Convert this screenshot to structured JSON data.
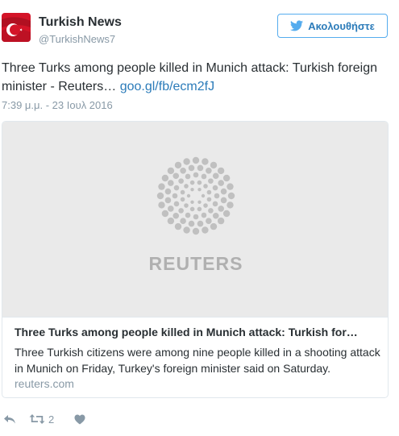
{
  "account": {
    "name": "Turkish News",
    "handle": "@TurkishNews7"
  },
  "follow_button": {
    "label": "Ακολουθήστε",
    "icon": "bird-icon"
  },
  "tweet": {
    "text": "Three Turks among people killed in Munich attack: Turkish foreign minister - Reuters…",
    "link": "goo.gl/fb/ecm2fJ",
    "timestamp": "7:39 μ.μ. - 23 Ιουλ 2016"
  },
  "card": {
    "logo_text": "REUTERS",
    "title": "Three Turks among people killed in Munich attack: Turkish for…",
    "description": "Three Turkish citizens were among nine people killed in a shooting attack in Munich on Friday, Turkey's foreign minister said on Saturday.",
    "domain": "reuters.com"
  },
  "actions": {
    "reply_icon": "reply-icon",
    "retweet_icon": "retweet-icon",
    "retweet_count": "2",
    "like_icon": "heart-icon"
  },
  "colors": {
    "link": "#2b7bb9",
    "muted": "#8899a6",
    "border": "#e1e8ed",
    "avatar_red": "#c8102e",
    "icon_gray": "#8899a6"
  }
}
